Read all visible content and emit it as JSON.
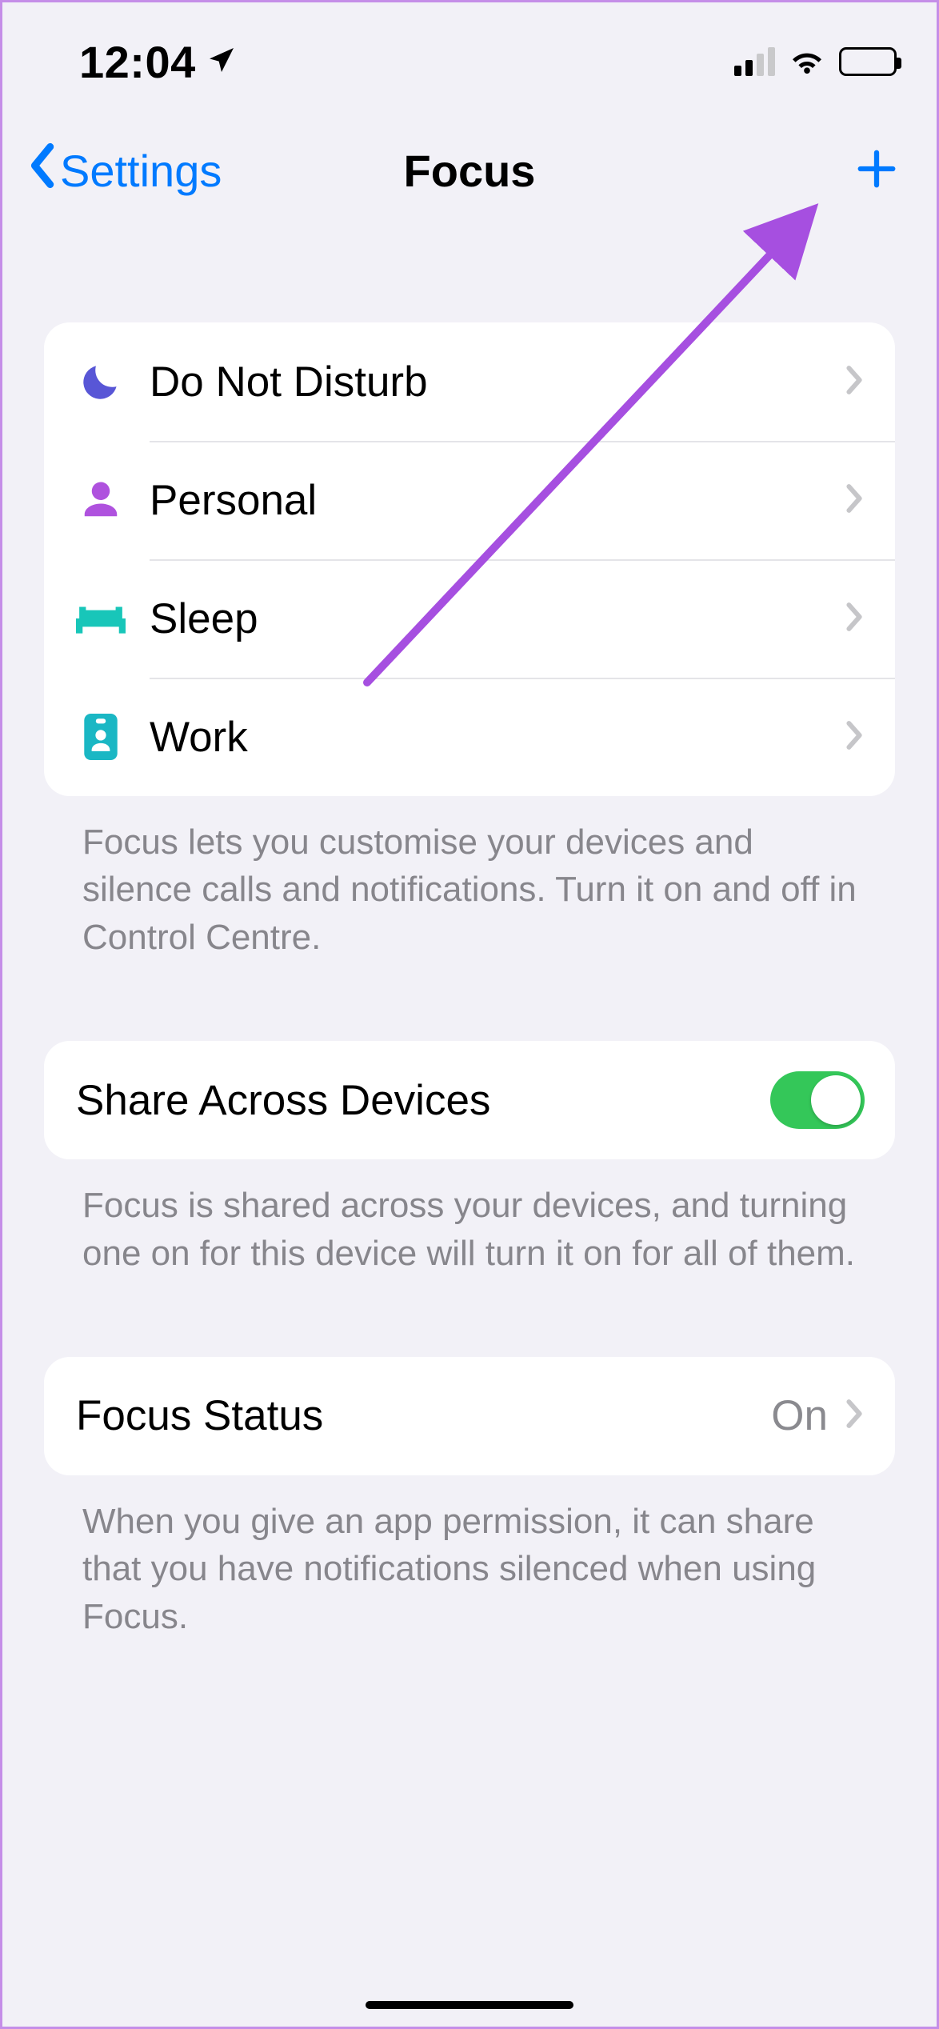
{
  "statusbar": {
    "time": "12:04"
  },
  "nav": {
    "back_label": "Settings",
    "title": "Focus"
  },
  "focus_modes": {
    "items": [
      {
        "label": "Do Not Disturb",
        "icon": "moon",
        "icon_color": "#5856d6"
      },
      {
        "label": "Personal",
        "icon": "person",
        "icon_color": "#af52de"
      },
      {
        "label": "Sleep",
        "icon": "bed",
        "icon_color": "#18c6b9"
      },
      {
        "label": "Work",
        "icon": "badge",
        "icon_color": "#1ab7c4"
      }
    ],
    "footer": "Focus lets you customise your devices and silence calls and notifications. Turn it on and off in Control Centre."
  },
  "share": {
    "label": "Share Across Devices",
    "enabled": true,
    "footer": "Focus is shared across your devices, and turning one on for this device will turn it on for all of them."
  },
  "status": {
    "label": "Focus Status",
    "value": "On",
    "footer": "When you give an app permission, it can share that you have notifications silenced when using Focus."
  },
  "annotation": {
    "arrow_color": "#a64fe0"
  }
}
